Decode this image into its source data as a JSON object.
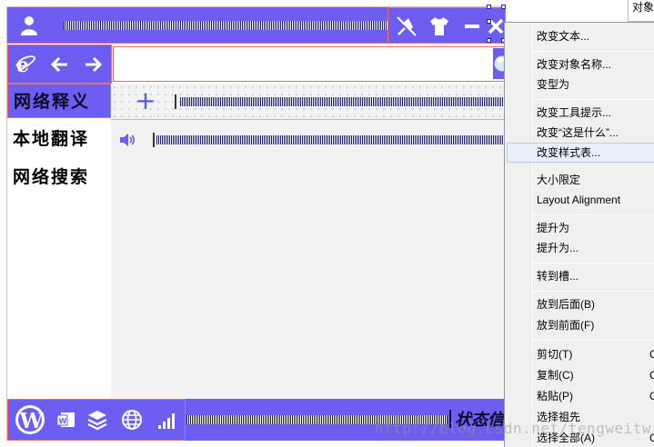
{
  "colors": {
    "bar_bg": "#6c5ef1",
    "highlight_border": "#ee6b6b",
    "menu_bg": "#f0f0f0",
    "menu_highlight": "#e8f0fb"
  },
  "titlebar": {
    "icons": [
      "user-icon",
      "pin-icon",
      "shirt-icon",
      "minimize-icon",
      "close-icon"
    ]
  },
  "navbar": {
    "icons": [
      "ie-browser-icon",
      "arrow-left-icon",
      "arrow-right-icon",
      "globe-icon"
    ],
    "url_value": ""
  },
  "sidebar": {
    "items": [
      {
        "label": "网络释义"
      },
      {
        "label": "本地翻译"
      },
      {
        "label": "网络搜索"
      }
    ]
  },
  "content": {
    "icons": [
      "plus-icon",
      "speaker-icon"
    ]
  },
  "statusbar": {
    "icons": [
      "wordpress-icon",
      "word-icon",
      "layers-icon",
      "globe-icon",
      "signal-icon"
    ],
    "status_text": "状态信"
  },
  "property_panel": {
    "label": "对象"
  },
  "context_menu": {
    "items": [
      {
        "label": "改变文本..."
      },
      {
        "label": "改变对象名称..."
      },
      {
        "label": "变型为"
      },
      {
        "label": "改变工具提示..."
      },
      {
        "label": "改变“这是什么”..."
      },
      {
        "label": "改变样式表..."
      },
      {
        "label": "大小限定"
      },
      {
        "label": "Layout Alignment"
      },
      {
        "label": "提升为"
      },
      {
        "label": "提升为..."
      },
      {
        "label": "转到槽..."
      },
      {
        "label": "放到后面(B)"
      },
      {
        "label": "放到前面(F)"
      },
      {
        "label": "剪切(T)",
        "shortcut": "C"
      },
      {
        "label": "复制(C)",
        "shortcut": "C"
      },
      {
        "label": "粘贴(P)",
        "shortcut": "C"
      },
      {
        "label": "选择祖先"
      },
      {
        "label": "选择全部(A)",
        "shortcut": "C"
      }
    ]
  },
  "watermark": "http://blog.csdn.net/tengweitw"
}
